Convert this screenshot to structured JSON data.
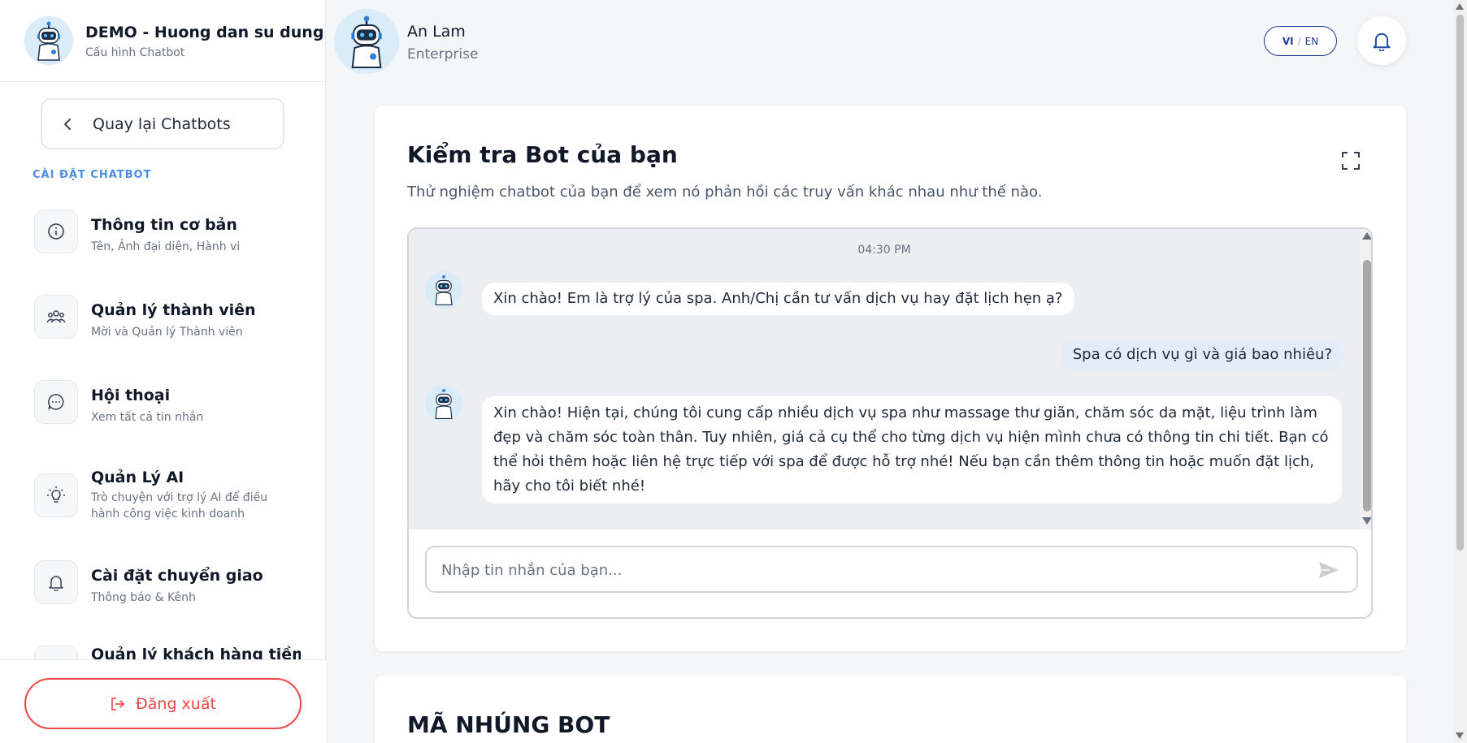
{
  "sidebar": {
    "header": {
      "title": "DEMO - Huong dan su dung",
      "subtitle": "Cấu hình Chatbot",
      "avatar_icon": "robot-icon"
    },
    "back_label": "Quay lại Chatbots",
    "section_label": "CÀI ĐẶT CHATBOT",
    "items": [
      {
        "title": "Thông tin cơ bản",
        "desc": "Tên, Ảnh đại diện, Hành vi",
        "icon": "info-icon"
      },
      {
        "title": "Quản lý thành viên",
        "desc": "Mời và Quản lý Thành viên",
        "icon": "users-icon"
      },
      {
        "title": "Hội thoại",
        "desc": "Xem tất cả tin nhắn",
        "icon": "chat-bubble-icon"
      },
      {
        "title": "Quản Lý AI",
        "desc": "Trò chuyện với trợ lý AI để điều hành công việc kinh doanh",
        "icon": "lightbulb-icon"
      },
      {
        "title": "Cài đặt chuyển giao",
        "desc": "Thông báo & Kênh",
        "icon": "bell-icon"
      },
      {
        "title": "Quản lý khách hàng tiềm",
        "desc": "",
        "icon": "funnel-icon"
      }
    ],
    "logout_label": "Đăng xuất"
  },
  "topbar": {
    "user_name": "An Lam",
    "user_plan": "Enterprise",
    "lang_active": "VI",
    "lang_sep": "/",
    "lang_other": "EN"
  },
  "test_card": {
    "title": "Kiểm tra Bot của bạn",
    "description": "Thử nghiệm chatbot của bạn để xem nó phản hồi các truy vấn khác nhau như thế nào.",
    "timestamp": "04:30 PM",
    "messages": [
      {
        "sender": "bot",
        "text": "Xin chào! Em là trợ lý của spa. Anh/Chị cần tư vấn dịch vụ hay đặt lịch hẹn ạ?"
      },
      {
        "sender": "user",
        "text": "Spa có dịch vụ gì và giá bao nhiêu?"
      },
      {
        "sender": "bot",
        "text": "Xin chào! Hiện tại, chúng tôi cung cấp nhiều dịch vụ spa như massage thư giãn, chăm sóc da mặt, liệu trình làm đẹp và chăm sóc toàn thân. Tuy nhiên, giá cả cụ thể cho từng dịch vụ hiện mình chưa có thông tin chi tiết. Bạn có thể hỏi thêm hoặc liên hệ trực tiếp với spa để được hỗ trợ nhé! Nếu bạn cần thêm thông tin hoặc muốn đặt lịch, hãy cho tôi biết nhé!"
      }
    ],
    "input_placeholder": "Nhập tin nhắn của bạn..."
  },
  "embed_card": {
    "title": "MÃ NHÚNG BOT"
  },
  "colors": {
    "accent": "#4a90e2",
    "danger": "#ef4444",
    "lang_border": "#1e3a8a"
  }
}
